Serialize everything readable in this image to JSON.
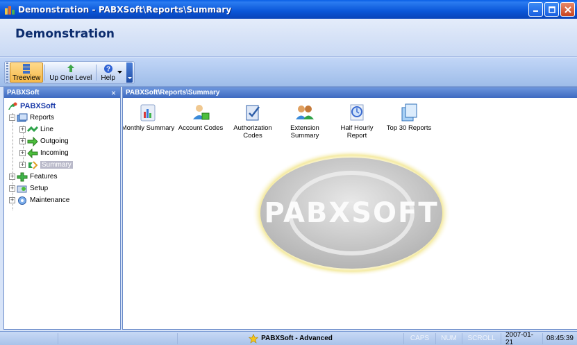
{
  "window": {
    "title": "Demonstration - PABXSoft\\Reports\\Summary"
  },
  "header": {
    "title": "Demonstration"
  },
  "toolbar": {
    "treeview": "Treeview",
    "up_one_level": "Up One Level",
    "help": "Help"
  },
  "left_panel": {
    "title": "PABXSoft",
    "close_glyph": "×",
    "tree": {
      "root": "PABXSoft",
      "reports": "Reports",
      "line": "Line",
      "outgoing": "Outgoing",
      "incoming": "Incoming",
      "summary": "Summary",
      "features": "Features",
      "setup": "Setup",
      "maintenance": "Maintenance"
    }
  },
  "right_panel": {
    "title": "PABXSoft\\Reports\\Summary",
    "items": [
      {
        "line1": "Monthly Summary",
        "line2": "",
        "icon": "monthly-summary-icon"
      },
      {
        "line1": "Account Codes",
        "line2": "",
        "icon": "account-codes-icon"
      },
      {
        "line1": "Authorization",
        "line2": "Codes",
        "icon": "authorization-codes-icon"
      },
      {
        "line1": "Extension",
        "line2": "Summary",
        "icon": "extension-summary-icon"
      },
      {
        "line1": "Half Hourly",
        "line2": "Report",
        "icon": "half-hourly-report-icon"
      },
      {
        "line1": "Top 30 Reports",
        "line2": "",
        "icon": "top-30-reports-icon"
      }
    ],
    "watermark": "PABXSOFT"
  },
  "status": {
    "product": "PABXSoft - Advanced",
    "caps": "CAPS",
    "num": "NUM",
    "scroll": "SCROLL",
    "date": "2007-01-21",
    "time": "08:45:39"
  },
  "colors": {
    "titlebar": "#0a56d8",
    "panel_head": "#3e6ac0",
    "selection": "#b9b9c9"
  }
}
